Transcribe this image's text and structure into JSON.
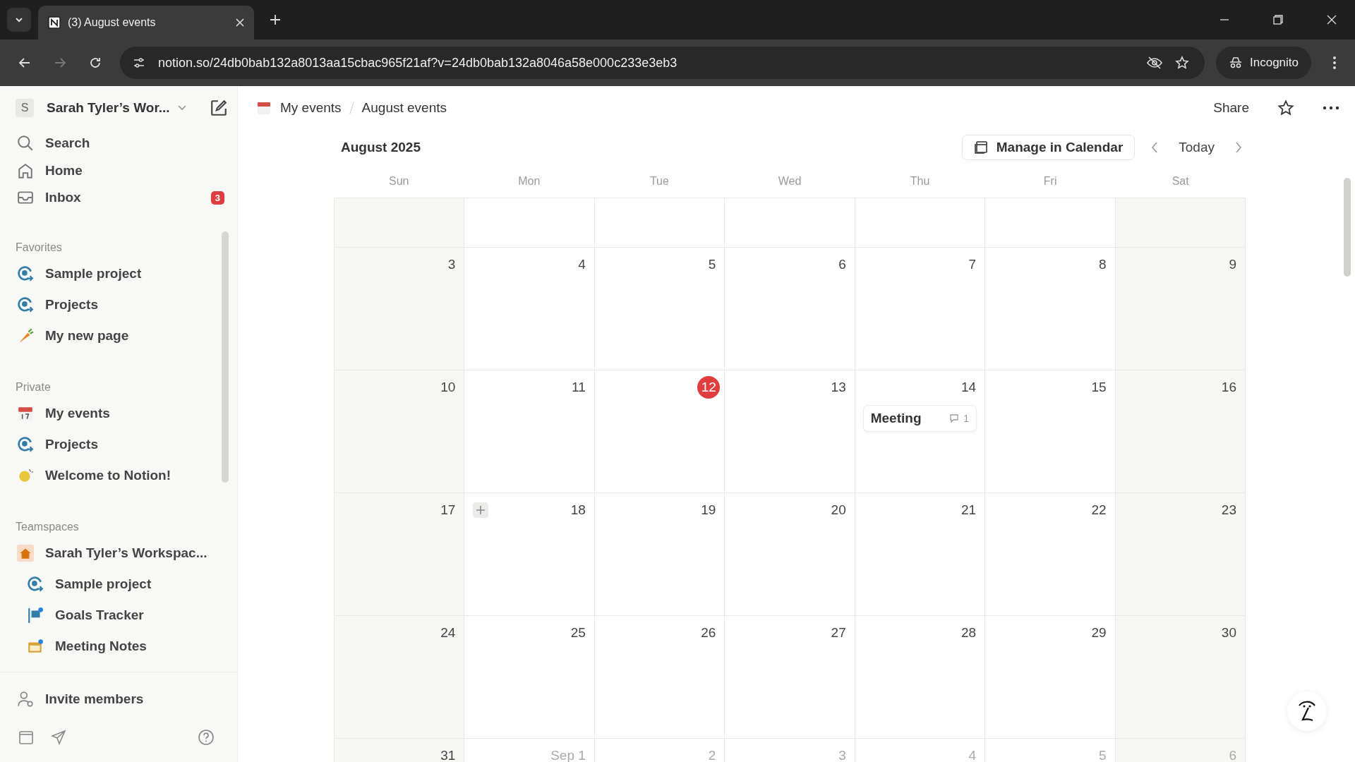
{
  "browser": {
    "tabs": [
      {
        "title": "(3) August events",
        "selected": true
      }
    ],
    "url": "notion.so/24db0bab132a8013aa15cbac965f21af?v=24db0bab132a8046a58e000c233e3eb3",
    "profile": "Incognito"
  },
  "sidebar": {
    "workspace": {
      "initial": "S",
      "name": "Sarah Tyler’s Wor..."
    },
    "nav": [
      {
        "label": "Search",
        "kind": "search"
      },
      {
        "label": "Home",
        "kind": "home"
      },
      {
        "label": "Inbox",
        "kind": "inbox",
        "badge": "3"
      }
    ],
    "sections": [
      {
        "title": "Favorites",
        "items": [
          {
            "label": "Sample project",
            "kind": "target"
          },
          {
            "label": "Projects",
            "kind": "target"
          },
          {
            "label": "My new page",
            "kind": "carrot"
          }
        ]
      },
      {
        "title": "Private",
        "items": [
          {
            "label": "My events",
            "kind": "calendar"
          },
          {
            "label": "Projects",
            "kind": "target"
          },
          {
            "label": "Welcome to Notion!",
            "kind": "sparkle"
          }
        ]
      },
      {
        "title": "Teamspaces",
        "items": [
          {
            "label": "Sarah Tyler’s Workspac...",
            "kind": "house",
            "children": [
              {
                "label": "Sample project",
                "kind": "target"
              },
              {
                "label": "Goals Tracker",
                "kind": "flag"
              },
              {
                "label": "Meeting Notes",
                "kind": "folder"
              }
            ]
          }
        ]
      }
    ],
    "invite": "Invite members"
  },
  "page": {
    "breadcrumbs": [
      {
        "label": "My events",
        "kind": "calendar"
      },
      {
        "label": "August events",
        "kind": "page"
      }
    ],
    "share": "Share"
  },
  "calendar": {
    "title": "August 2025",
    "manage_button": "Manage in Calendar",
    "today_button": "Today",
    "weekdays": [
      "Sun",
      "Mon",
      "Tue",
      "Wed",
      "Thu",
      "Fri",
      "Sat"
    ],
    "weeks": [
      {
        "short": true
      },
      {
        "short": false,
        "days": [
          {
            "label": "3",
            "muted": false,
            "today": false,
            "hovered": false
          },
          {
            "label": "4",
            "muted": false,
            "today": false,
            "hovered": false
          },
          {
            "label": "5",
            "muted": false,
            "today": false,
            "hovered": false
          },
          {
            "label": "6",
            "muted": false,
            "today": false,
            "hovered": false
          },
          {
            "label": "7",
            "muted": false,
            "today": false,
            "hovered": false
          },
          {
            "label": "8",
            "muted": false,
            "today": false,
            "hovered": false
          },
          {
            "label": "9",
            "muted": false,
            "today": false,
            "hovered": false
          }
        ]
      },
      {
        "short": false,
        "days": [
          {
            "label": "10",
            "muted": false,
            "today": false,
            "hovered": false
          },
          {
            "label": "11",
            "muted": false,
            "today": false,
            "hovered": false
          },
          {
            "label": "12",
            "muted": false,
            "today": true,
            "hovered": false
          },
          {
            "label": "13",
            "muted": false,
            "today": false,
            "hovered": false
          },
          {
            "label": "14",
            "muted": false,
            "today": false,
            "hovered": false,
            "events": [
              {
                "title": "Meeting",
                "comments": "1"
              }
            ]
          },
          {
            "label": "15",
            "muted": false,
            "today": false,
            "hovered": false
          },
          {
            "label": "16",
            "muted": false,
            "today": false,
            "hovered": false
          }
        ]
      },
      {
        "short": false,
        "days": [
          {
            "label": "17",
            "muted": false,
            "today": false,
            "hovered": false
          },
          {
            "label": "18",
            "muted": false,
            "today": false,
            "hovered": true
          },
          {
            "label": "19",
            "muted": false,
            "today": false,
            "hovered": false
          },
          {
            "label": "20",
            "muted": false,
            "today": false,
            "hovered": false
          },
          {
            "label": "21",
            "muted": false,
            "today": false,
            "hovered": false
          },
          {
            "label": "22",
            "muted": false,
            "today": false,
            "hovered": false
          },
          {
            "label": "23",
            "muted": false,
            "today": false,
            "hovered": false
          }
        ]
      },
      {
        "short": false,
        "days": [
          {
            "label": "24",
            "muted": false,
            "today": false,
            "hovered": false
          },
          {
            "label": "25",
            "muted": false,
            "today": false,
            "hovered": false
          },
          {
            "label": "26",
            "muted": false,
            "today": false,
            "hovered": false
          },
          {
            "label": "27",
            "muted": false,
            "today": false,
            "hovered": false
          },
          {
            "label": "28",
            "muted": false,
            "today": false,
            "hovered": false
          },
          {
            "label": "29",
            "muted": false,
            "today": false,
            "hovered": false
          },
          {
            "label": "30",
            "muted": false,
            "today": false,
            "hovered": false
          }
        ]
      },
      {
        "short": false,
        "days": [
          {
            "label": "31",
            "muted": false,
            "today": false,
            "hovered": false
          },
          {
            "label": "Sep 1",
            "muted": true,
            "today": false,
            "hovered": false
          },
          {
            "label": "2",
            "muted": true,
            "today": false,
            "hovered": false
          },
          {
            "label": "3",
            "muted": true,
            "today": false,
            "hovered": false
          },
          {
            "label": "4",
            "muted": true,
            "today": false,
            "hovered": false
          },
          {
            "label": "5",
            "muted": true,
            "today": false,
            "hovered": false
          },
          {
            "label": "6",
            "muted": true,
            "today": false,
            "hovered": false
          }
        ]
      }
    ]
  }
}
